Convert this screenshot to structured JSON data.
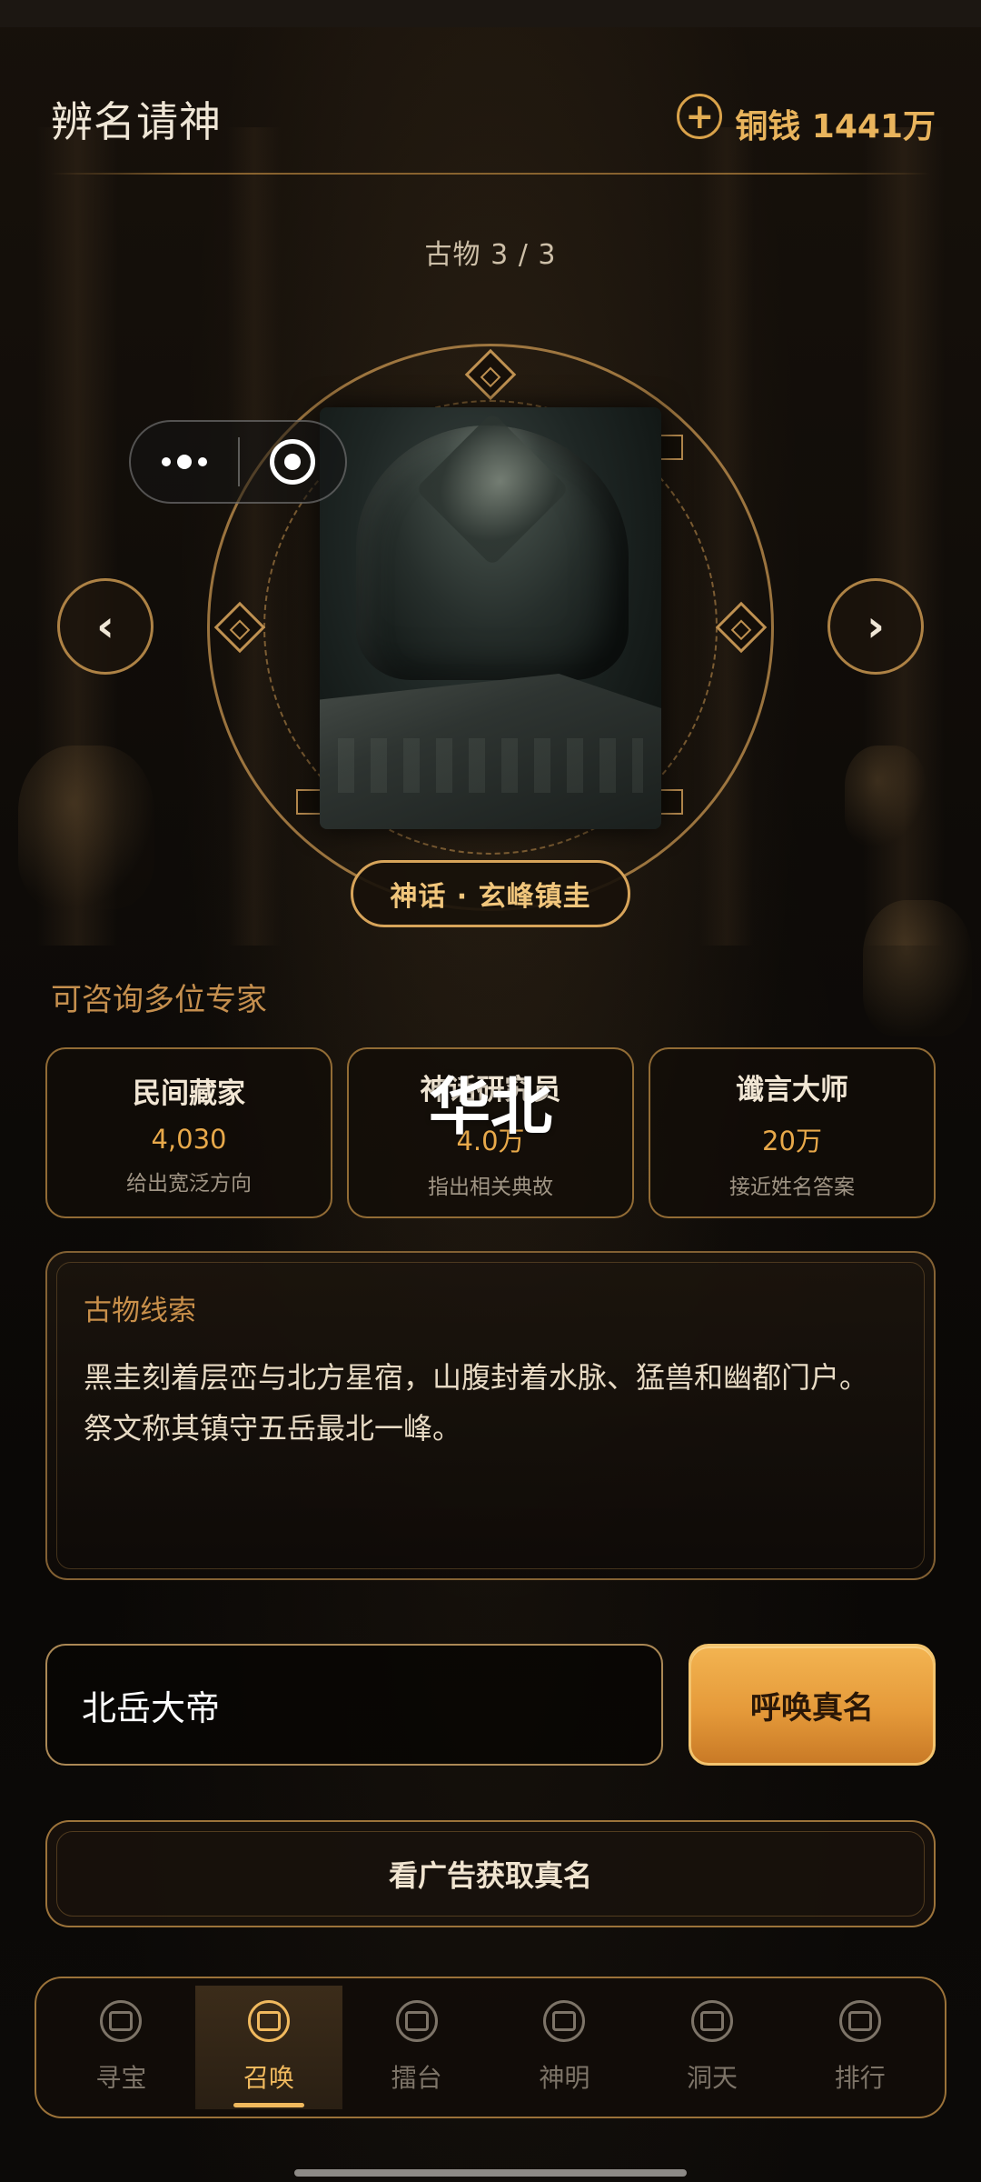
{
  "header": {
    "title": "辨名请神",
    "currency_label": "铜钱 1441万",
    "add_currency_icon": "plus-circle-icon"
  },
  "artifact": {
    "counter": "古物 3 / 3",
    "name": "神话 · 玄峰镇圭",
    "image": "jade-seal-image"
  },
  "experts_section": {
    "label": "可咨询多位专家",
    "floating_text": "华北",
    "experts": [
      {
        "name": "民间藏家",
        "price": "4,030",
        "desc": "给出宽泛方向"
      },
      {
        "name": "神话研究员",
        "price": "4.0万",
        "desc": "指出相关典故"
      },
      {
        "name": "谶言大师",
        "price": "20万",
        "desc": "接近姓名答案"
      }
    ]
  },
  "clue": {
    "title": "古物线索",
    "line1": "黑圭刻着层峦与北方星宿，山腹封着水脉、猛兽和幽都门户。",
    "line2": "祭文称其镇守五岳最北一峰。"
  },
  "answer": {
    "value": "北岳大帝",
    "summon_label": "呼唤真名"
  },
  "ad": {
    "label": "看广告获取真名"
  },
  "bottom_nav": {
    "items": [
      {
        "label": "寻宝",
        "icon": "treasure-icon"
      },
      {
        "label": "召唤",
        "icon": "summon-icon",
        "active": true
      },
      {
        "label": "擂台",
        "icon": "arena-icon"
      },
      {
        "label": "神明",
        "icon": "deity-icon"
      },
      {
        "label": "洞天",
        "icon": "grotto-icon"
      },
      {
        "label": "排行",
        "icon": "ranking-icon"
      }
    ]
  },
  "colors": {
    "accent": "#e9b45c",
    "panel_border": "#be8c46",
    "button_gradient_top": "#f3b451",
    "button_gradient_bottom": "#c97a26"
  }
}
